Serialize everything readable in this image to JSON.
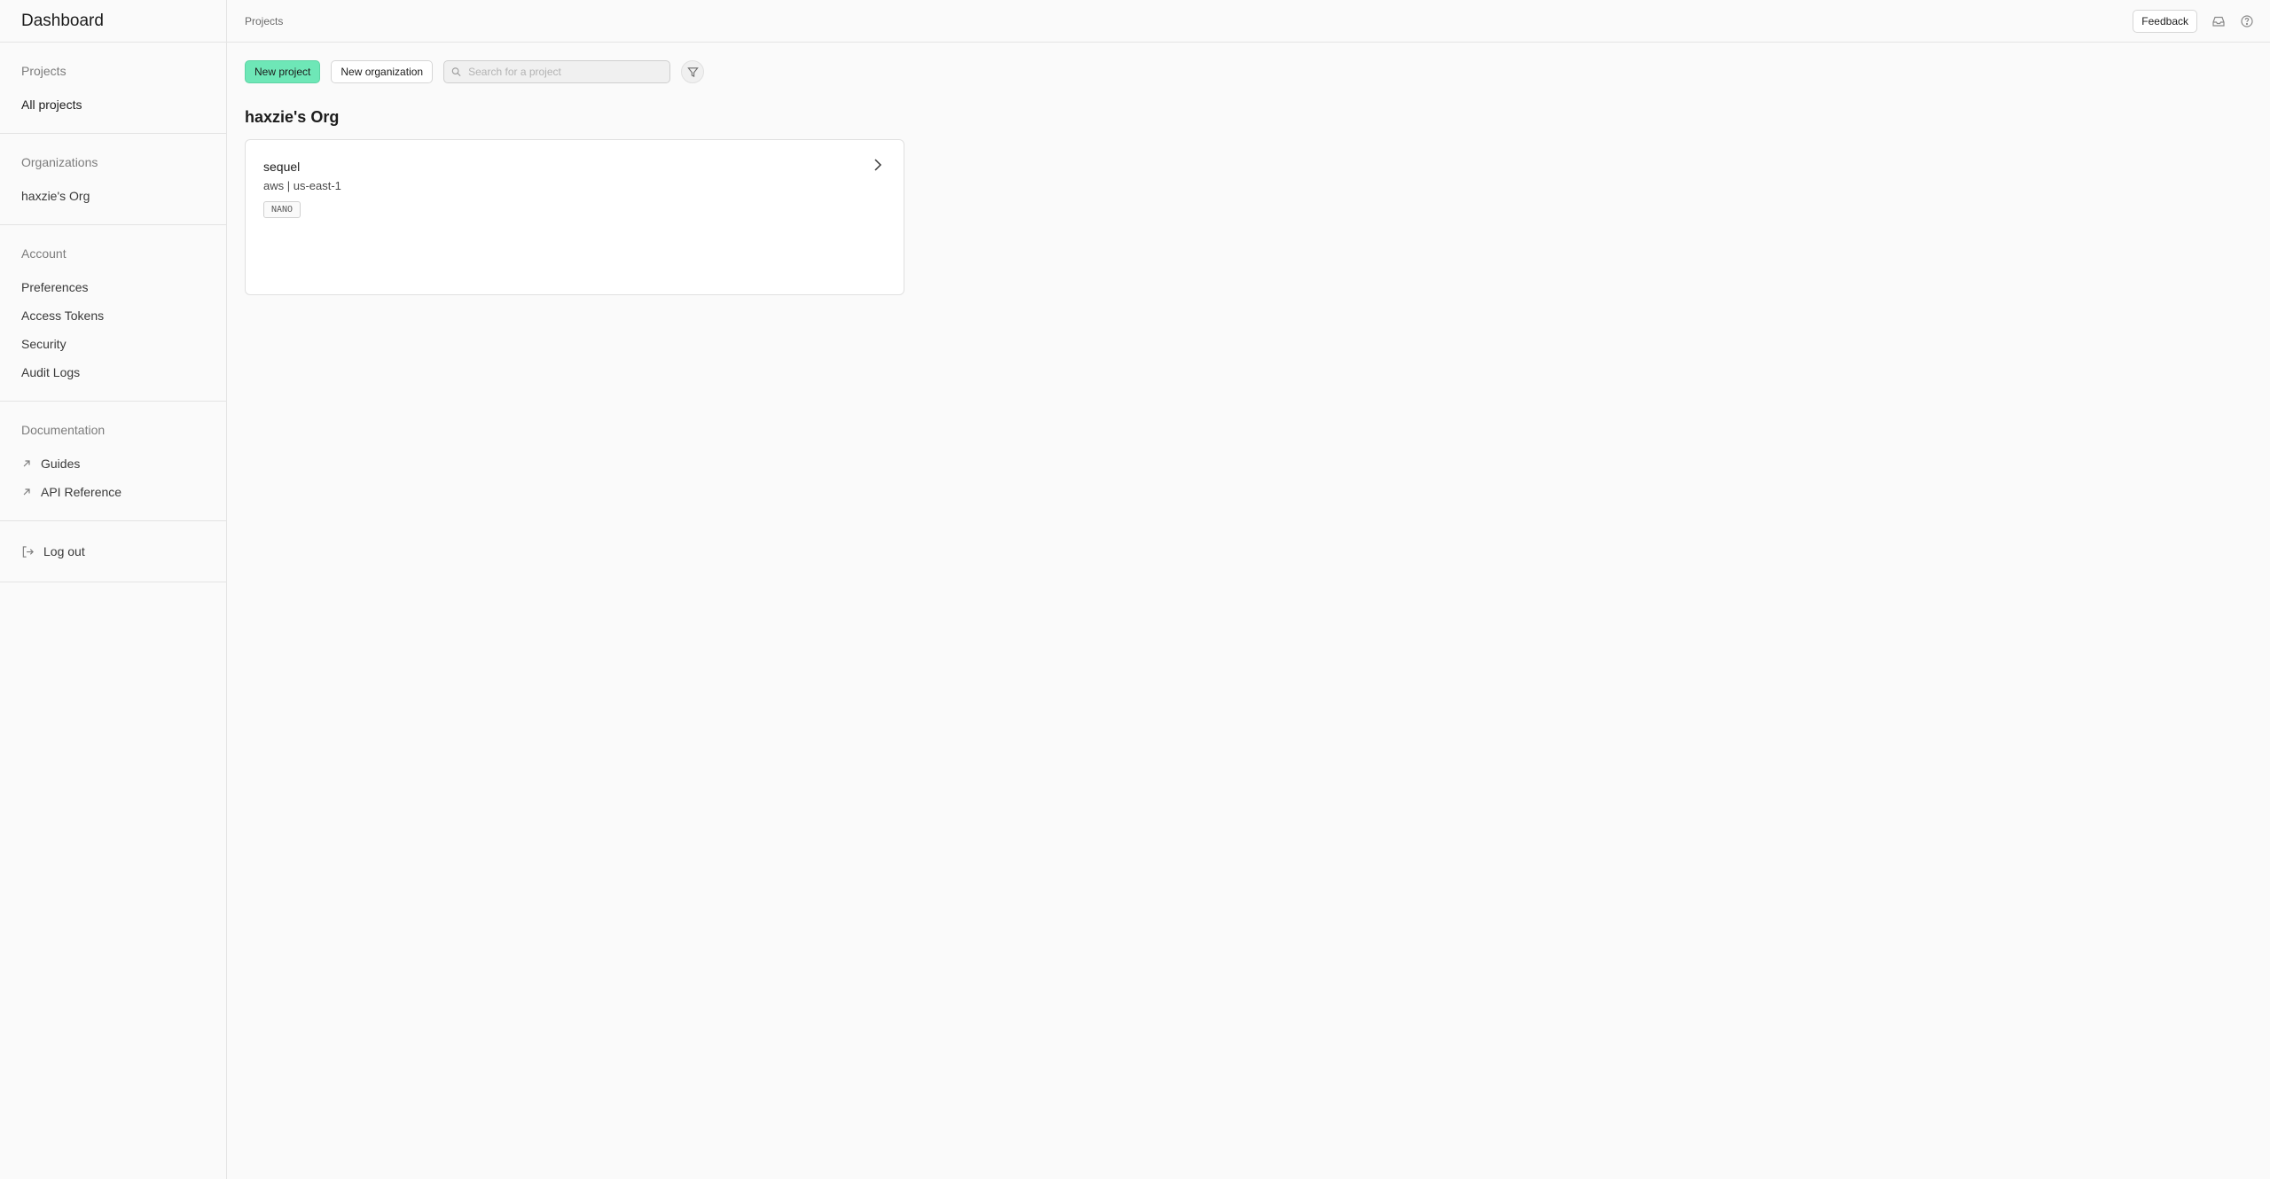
{
  "sidebar": {
    "title": "Dashboard",
    "sections": {
      "projects": {
        "heading": "Projects",
        "items": [
          "All projects"
        ]
      },
      "organizations": {
        "heading": "Organizations",
        "items": [
          "haxzie's Org"
        ]
      },
      "account": {
        "heading": "Account",
        "items": [
          "Preferences",
          "Access Tokens",
          "Security",
          "Audit Logs"
        ]
      },
      "documentation": {
        "heading": "Documentation",
        "items": [
          "Guides",
          "API Reference"
        ]
      }
    },
    "logout_label": "Log out"
  },
  "topbar": {
    "breadcrumb": "Projects",
    "feedback_label": "Feedback",
    "icons": [
      "inbox-icon",
      "help-icon"
    ]
  },
  "toolbar": {
    "new_project_label": "New project",
    "new_organization_label": "New organization",
    "search_placeholder": "Search for a project",
    "search_value": ""
  },
  "org": {
    "name": "haxzie's Org",
    "projects": [
      {
        "name": "sequel",
        "region": "aws | us-east-1",
        "size_badge": "NANO"
      }
    ]
  },
  "colors": {
    "accent": "#6ee7b7",
    "background": "#fafafa",
    "border": "#e4e4e4"
  }
}
